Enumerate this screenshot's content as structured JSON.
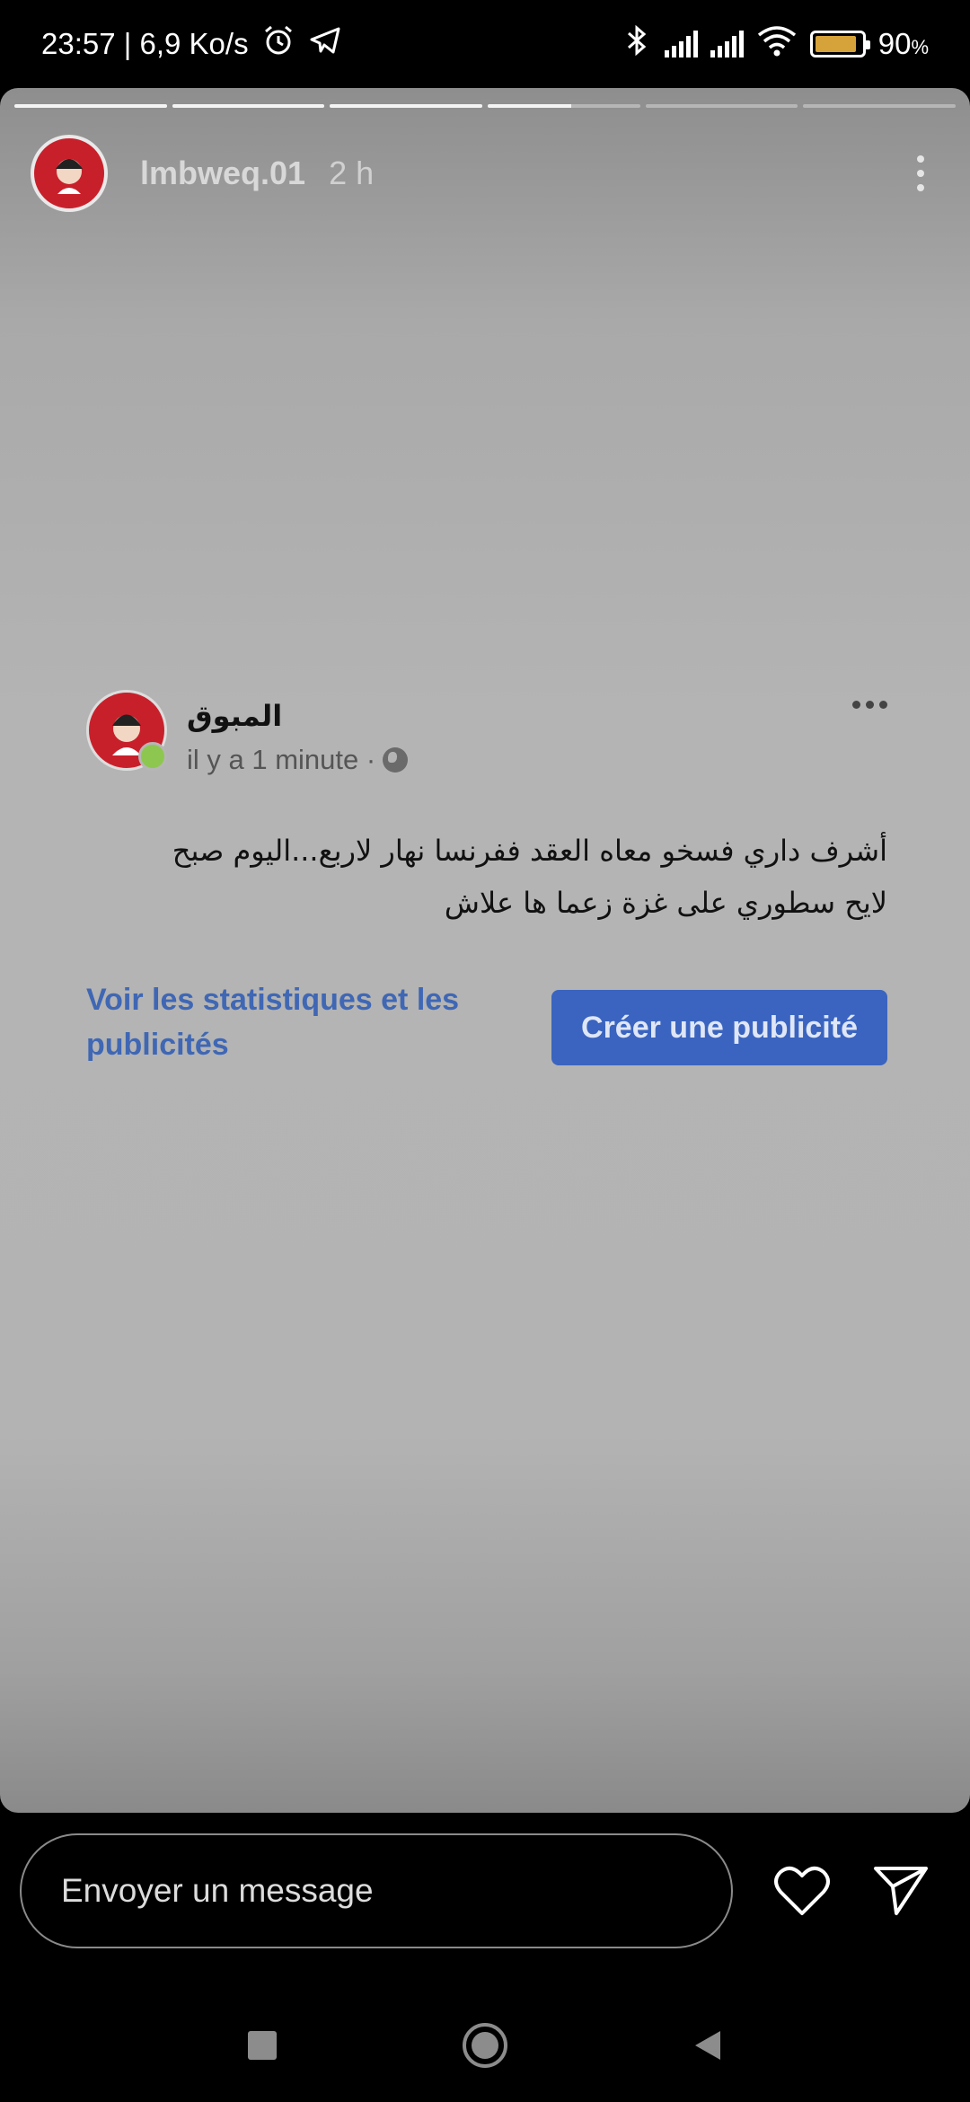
{
  "status_bar": {
    "time_speed": "23:57 | 6,9 Ko/s",
    "battery_pct": "90",
    "battery_level": 0.9,
    "icons": [
      "alarm-icon",
      "telegram-icon",
      "bluetooth-icon",
      "signal-icon",
      "signal-icon",
      "wifi-icon",
      "battery-icon"
    ]
  },
  "story": {
    "username": "lmbweq.01",
    "time": "2 h",
    "segments": [
      1,
      1,
      1,
      0.55,
      0,
      0
    ]
  },
  "post": {
    "author": "المبوق",
    "meta": "il y a 1 minute ·",
    "text_line1": "أشرف داري فسخو معاه العقد ففرنسا نهار لاربع...اليوم صبح",
    "text_line2": "لايح سطوري على غزة زعما ها علاش",
    "stats_link": "Voir les statistiques et les publicités",
    "create_ad": "Créer une publicité"
  },
  "reply": {
    "placeholder": "Envoyer un message"
  },
  "colors": {
    "link": "#3f67b4",
    "button": "#3a64bf",
    "avatar_red": "#c8202b",
    "battery": "#d6a23a"
  }
}
